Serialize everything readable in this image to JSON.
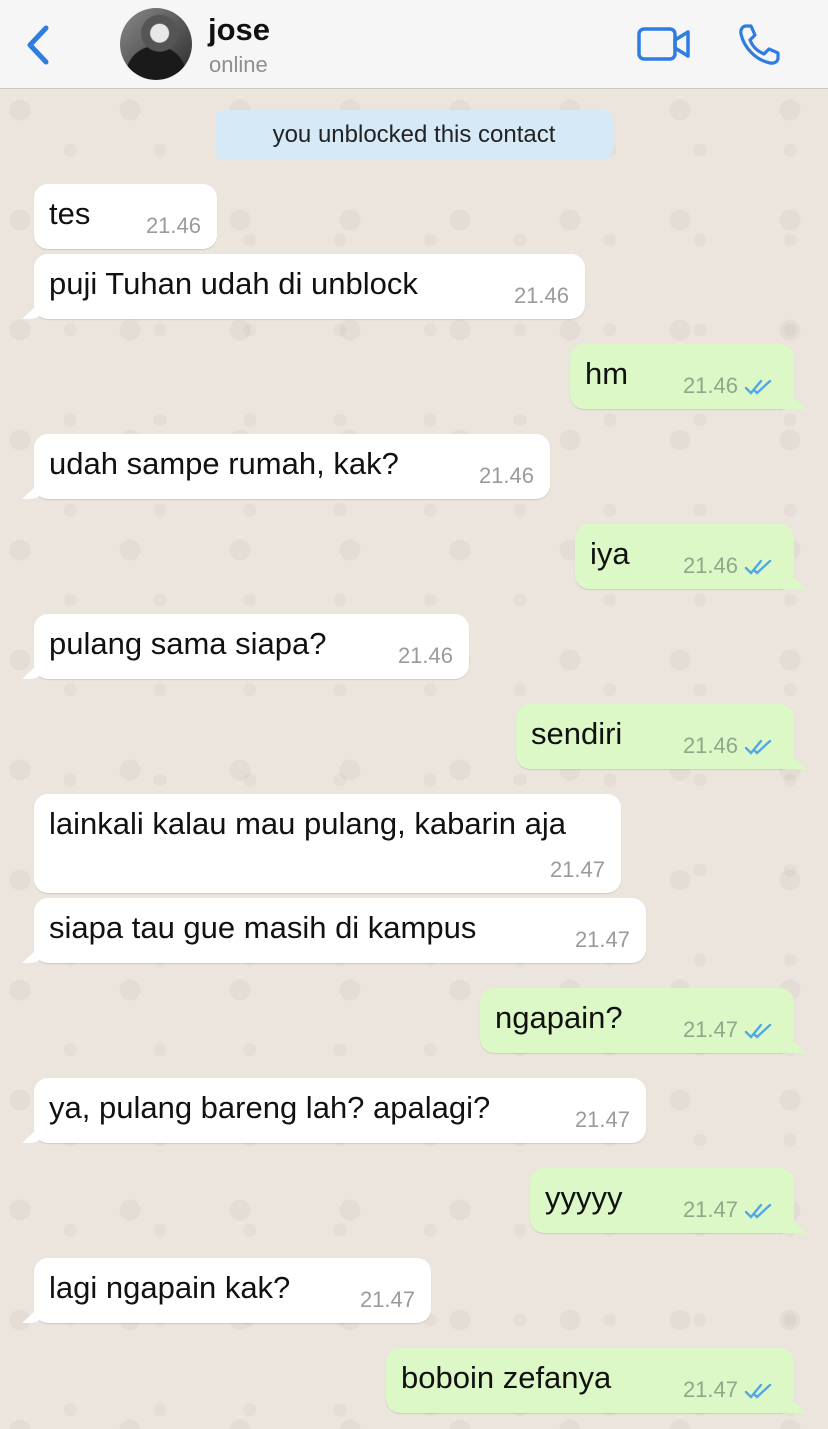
{
  "header": {
    "back_icon": "chevron-left-icon",
    "contact_name": "jose",
    "contact_status": "online",
    "video_icon": "video-camera-icon",
    "call_icon": "phone-icon",
    "accent_color": "#2f7de1"
  },
  "chat": {
    "system_note": "you unblocked this contact",
    "messages": [
      {
        "direction": "in",
        "text": "tes",
        "time": "21.46"
      },
      {
        "direction": "in",
        "text": "puji Tuhan udah di unblock",
        "time": "21.46"
      },
      {
        "direction": "out",
        "text": "hm",
        "time": "21.46",
        "status": "read"
      },
      {
        "direction": "in",
        "text": "udah sampe rumah, kak?",
        "time": "21.46"
      },
      {
        "direction": "out",
        "text": "iya",
        "time": "21.46",
        "status": "read"
      },
      {
        "direction": "in",
        "text": "pulang sama siapa?",
        "time": "21.46"
      },
      {
        "direction": "out",
        "text": "sendiri",
        "time": "21.46",
        "status": "read"
      },
      {
        "direction": "in",
        "text": "lainkali kalau mau pulang, kabarin aja",
        "time": "21.47"
      },
      {
        "direction": "in",
        "text": "siapa tau gue masih di kampus",
        "time": "21.47"
      },
      {
        "direction": "out",
        "text": "ngapain?",
        "time": "21.47",
        "status": "read"
      },
      {
        "direction": "in",
        "text": "ya, pulang bareng lah? apalagi?",
        "time": "21.47"
      },
      {
        "direction": "out",
        "text": "yyyyy",
        "time": "21.47",
        "status": "read"
      },
      {
        "direction": "in",
        "text": "lagi ngapain kak?",
        "time": "21.47"
      },
      {
        "direction": "out",
        "text": "boboin zefanya",
        "time": "21.47",
        "status": "read"
      }
    ]
  },
  "colors": {
    "incoming_bubble": "#ffffff",
    "outgoing_bubble": "#dcf8c6",
    "read_tick": "#4fa9e8",
    "system_note_bg": "#d6e9f6"
  }
}
